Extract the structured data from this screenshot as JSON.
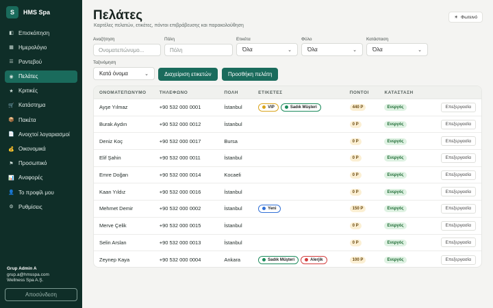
{
  "brand": {
    "logo": "S",
    "name": "HMS Spa"
  },
  "nav": [
    {
      "label": "Επισκόπηση",
      "icon": "dashboard-icon",
      "glyph": "◧",
      "active": false
    },
    {
      "label": "Ημερολόγιο",
      "icon": "calendar-icon",
      "glyph": "▦",
      "active": false
    },
    {
      "label": "Ραντεβού",
      "icon": "list-icon",
      "glyph": "☰",
      "active": false
    },
    {
      "label": "Πελάτες",
      "icon": "users-icon",
      "glyph": "◉",
      "active": true
    },
    {
      "label": "Κριτικές",
      "icon": "star-icon",
      "glyph": "★",
      "active": false
    },
    {
      "label": "Κατάστημα",
      "icon": "cart-icon",
      "glyph": "🛒",
      "active": false
    },
    {
      "label": "Πακέτα",
      "icon": "package-icon",
      "glyph": "📦",
      "active": false
    },
    {
      "label": "Ανοιχτοί λογαριασμοί",
      "icon": "receipt-icon",
      "glyph": "📄",
      "active": false
    },
    {
      "label": "Οικονομικά",
      "icon": "money-icon",
      "glyph": "💰",
      "active": false
    },
    {
      "label": "Προσωπικό",
      "icon": "flag-icon",
      "glyph": "⚑",
      "active": false
    },
    {
      "label": "Αναφορές",
      "icon": "chart-icon",
      "glyph": "📊",
      "active": false
    },
    {
      "label": "Το προφίλ μου",
      "icon": "profile-icon",
      "glyph": "👤",
      "active": false
    },
    {
      "label": "Ρυθμίσεις",
      "icon": "gear-icon",
      "glyph": "⚙",
      "active": false
    }
  ],
  "user": {
    "name": "Grup Admin A",
    "email": "grup.a@hmsspa.com",
    "org": "Wellness Spa A.Ş."
  },
  "logout_label": "Αποσύνδεση",
  "header": {
    "title": "Πελάτες",
    "subtitle": "Καρτέλες πελατών, ετικέτες, πόντοι επιβράβευσης και παρακολούθηση",
    "theme_label": "Φωτεινό",
    "theme_glyph": "☀"
  },
  "filters": {
    "search_label": "Αναζήτηση",
    "search_placeholder": "Ονοματεπώνυμο...",
    "city_label": "Πόλη",
    "city_placeholder": "Πόλη",
    "tag_label": "Ετικέτα",
    "tag_value": "Όλα",
    "gender_label": "Φύλο",
    "gender_value": "Όλα",
    "status_label": "Κατάσταση",
    "status_value": "Όλα",
    "sort_label": "Ταξινόμηση",
    "sort_value": "Κατά όνομα",
    "manage_tags_label": "Διαχείριση ετικετών",
    "add_customer_label": "Προσθήκη πελάτη"
  },
  "table": {
    "headers": [
      "ΟΝΟΜΑΤΕΠΩΝΥΜΟ",
      "ΤΗΛΕΦΩΝΟ",
      "ΠΟΛΗ",
      "ΕΤΙΚΕΤΕΣ",
      "ΠΟΝΤΟΙ",
      "ΚΑΤΑΣΤΑΣΗ",
      ""
    ],
    "edit_label": "Επεξεργασία",
    "rows": [
      {
        "name": "Ayşe Yılmaz",
        "phone": "+90 532 000 0001",
        "city": "İstanbul",
        "tags": [
          {
            "label": "VIP",
            "color": "#d9a31a"
          },
          {
            "label": "Sadık Müşteri",
            "color": "#1a8a5a"
          }
        ],
        "points": "440 P",
        "status": "Ενεργός"
      },
      {
        "name": "Burak Aydın",
        "phone": "+90 532 000 0012",
        "city": "İstanbul",
        "tags": [],
        "points": "0 P",
        "status": "Ενεργός"
      },
      {
        "name": "Deniz Koç",
        "phone": "+90 532 000 0017",
        "city": "Bursa",
        "tags": [],
        "points": "0 P",
        "status": "Ενεργός"
      },
      {
        "name": "Elif Şahin",
        "phone": "+90 532 000 0011",
        "city": "İstanbul",
        "tags": [],
        "points": "0 P",
        "status": "Ενεργός"
      },
      {
        "name": "Emre Doğan",
        "phone": "+90 532 000 0014",
        "city": "Kocaeli",
        "tags": [],
        "points": "0 P",
        "status": "Ενεργός"
      },
      {
        "name": "Kaan Yıldız",
        "phone": "+90 532 000 0016",
        "city": "İstanbul",
        "tags": [],
        "points": "0 P",
        "status": "Ενεργός"
      },
      {
        "name": "Mehmet Demir",
        "phone": "+90 532 000 0002",
        "city": "İstanbul",
        "tags": [
          {
            "label": "Yeni",
            "color": "#2f6fd6"
          }
        ],
        "points": "150 P",
        "status": "Ενεργός"
      },
      {
        "name": "Merve Çelik",
        "phone": "+90 532 000 0015",
        "city": "İstanbul",
        "tags": [],
        "points": "0 P",
        "status": "Ενεργός"
      },
      {
        "name": "Selin Arslan",
        "phone": "+90 532 000 0013",
        "city": "İstanbul",
        "tags": [],
        "points": "0 P",
        "status": "Ενεργός"
      },
      {
        "name": "Zeynep Kaya",
        "phone": "+90 532 000 0004",
        "city": "Ankara",
        "tags": [
          {
            "label": "Sadık Müşteri",
            "color": "#1a8a5a"
          },
          {
            "label": "Alerjik",
            "color": "#d23b3b"
          }
        ],
        "points": "100 P",
        "status": "Ενεργός"
      }
    ]
  }
}
